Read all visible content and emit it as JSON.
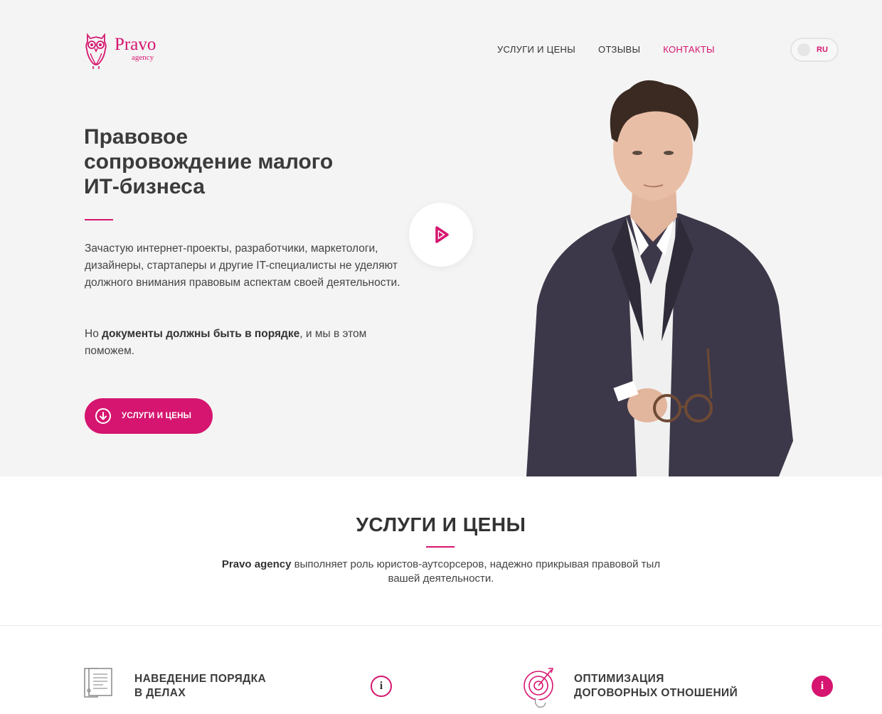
{
  "brand": {
    "name": "Pravo",
    "sub": "agency"
  },
  "nav": {
    "items": [
      {
        "label": "УСЛУГИ И ЦЕНЫ",
        "active": false
      },
      {
        "label": "ОТЗЫВЫ",
        "active": false
      },
      {
        "label": "КОНТАКТЫ",
        "active": true
      }
    ]
  },
  "lang": {
    "current": "RU"
  },
  "hero": {
    "title": "Правовое сопровождение малого ИТ-бизнеса",
    "paragraph": "Зачастую интернет-проекты, разработчики, маркетологи, дизайнеры, стартаперы и другие IT-специалисты не уделяют должного внимания правовым аспектам своей деятельности.",
    "p2_start": "Но ",
    "p2_bold": "документы должны быть в порядке",
    "p2_end": ", и мы в этом поможем.",
    "cta_label": "УСЛУГИ И ЦЕНЫ"
  },
  "services": {
    "title": "УСЛУГИ И ЦЕНЫ",
    "desc_bold": "Pravo agency",
    "desc_rest": " выполняет роль юристов-аутсорсеров, надежно прикрывая правовой тыл вашей деятельности.",
    "items": [
      {
        "label_line1": "НАВЕДЕНИЕ ПОРЯДКА",
        "label_line2": "В ДЕЛАХ",
        "icon": "documents-icon",
        "info": "i"
      },
      {
        "label_line1": "ОПТИМИЗАЦИЯ",
        "label_line2": "ДОГОВОРНЫХ ОТНОШЕНИЙ",
        "icon": "target-icon",
        "info": "i"
      }
    ]
  },
  "colors": {
    "accent": "#d5156f",
    "hero_bg": "#f4f4f4",
    "text": "#333333"
  }
}
